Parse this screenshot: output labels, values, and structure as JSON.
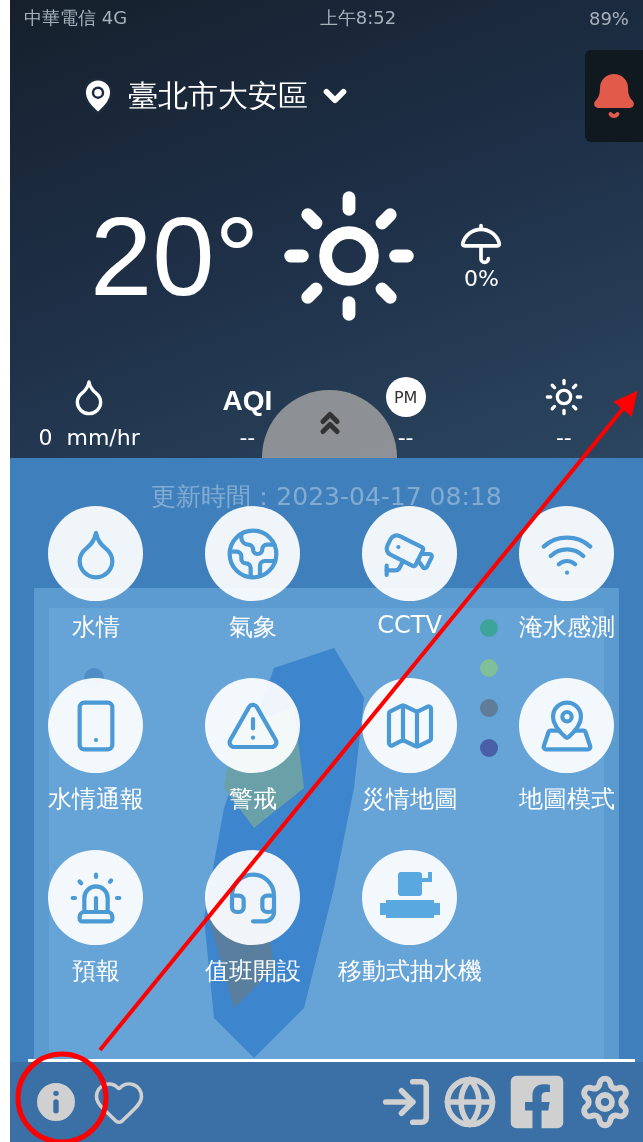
{
  "status_bar": {
    "carrier": "中華電信",
    "network": "4G",
    "time": "上午8:52",
    "battery": "89%"
  },
  "location": {
    "name": "臺北市大安區"
  },
  "weather": {
    "temperature": "20°",
    "rain_chance": "0%"
  },
  "metrics": [
    {
      "kind": "icon",
      "value": "0  mm/hr"
    },
    {
      "kind": "text",
      "label": "AQI",
      "value": "--"
    },
    {
      "kind": "badge",
      "label": "PM",
      "value": "--"
    },
    {
      "kind": "icon",
      "value": "--"
    }
  ],
  "update_time": "更新時間：2023-04-17 08:18",
  "menu": [
    {
      "label": "水情"
    },
    {
      "label": "氣象"
    },
    {
      "label": "CCTV"
    },
    {
      "label": "淹水感測"
    },
    {
      "label": "水情通報"
    },
    {
      "label": "警戒"
    },
    {
      "label": "災情地圖"
    },
    {
      "label": "地圖模式"
    },
    {
      "label": "預報"
    },
    {
      "label": "值班開設"
    },
    {
      "label": "移動式抽水機"
    }
  ],
  "annotation": {
    "kind": "arrow"
  }
}
